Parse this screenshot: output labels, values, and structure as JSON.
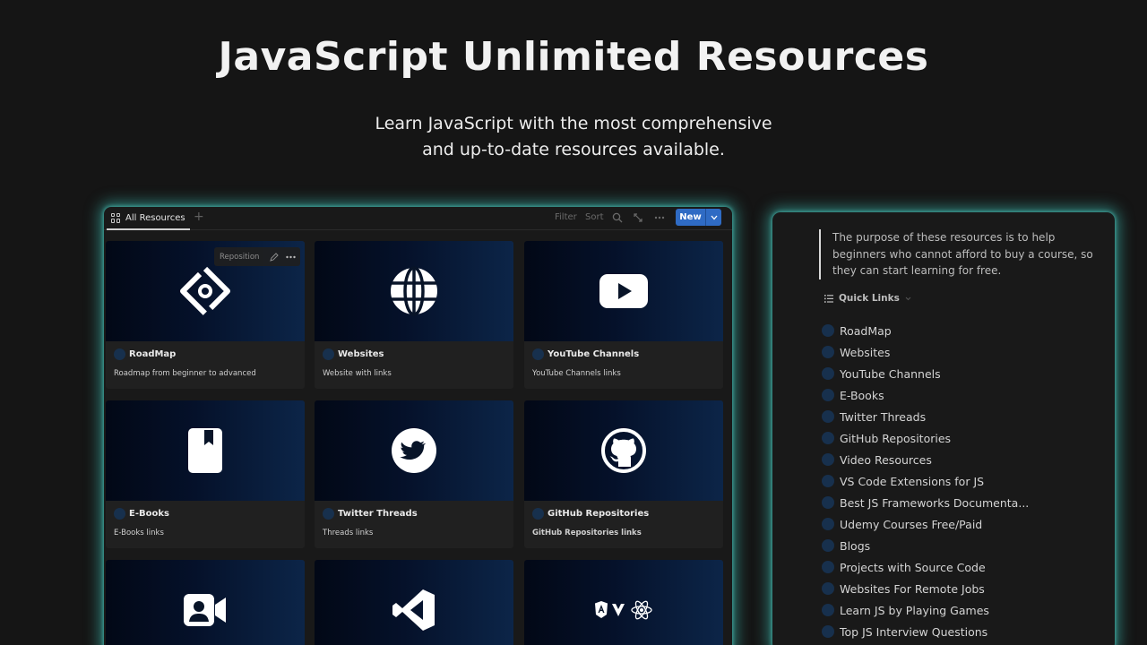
{
  "hero": {
    "title": "JavaScript Unlimited Resources",
    "subtitle_line1": "Learn JavaScript with the most comprehensive",
    "subtitle_line2": "and up-to-date resources available."
  },
  "database": {
    "tab_label": "All Resources",
    "add_symbol": "+",
    "filter_label": "Filter",
    "sort_label": "Sort",
    "new_label": "New",
    "hover_reposition": "Reposition",
    "cards": [
      {
        "title": "RoadMap",
        "desc": "Roadmap from beginner to advanced",
        "icon": "roadmap-icon"
      },
      {
        "title": "Websites",
        "desc": "Website with links",
        "icon": "globe-icon"
      },
      {
        "title": "YouTube Channels",
        "desc": "YouTube Channels links",
        "icon": "youtube-icon"
      },
      {
        "title": "E-Books",
        "desc": "E-Books links",
        "icon": "book-icon"
      },
      {
        "title": "Twitter Threads",
        "desc": "Threads links",
        "icon": "twitter-icon"
      },
      {
        "title": "GitHub Repositories",
        "desc": "GitHub Repositories links",
        "icon": "github-icon"
      },
      {
        "title": "",
        "desc": "",
        "icon": "video-call-icon"
      },
      {
        "title": "",
        "desc": "",
        "icon": "vscode-icon"
      },
      {
        "title": "",
        "desc": "",
        "icon": "frameworks-icon"
      }
    ]
  },
  "side": {
    "quote": "The purpose of these resources is to help beginners who cannot afford to buy a course, so they can start learning for free.",
    "quick_links_label": "Quick Links",
    "links": [
      "RoadMap",
      "Websites",
      "YouTube Channels",
      "E-Books",
      "Twitter Threads",
      "GitHub Repositories",
      "Video Resources",
      "VS Code Extensions for JS",
      "Best JS Frameworks Documenta...",
      "Udemy Courses Free/Paid",
      "Blogs",
      "Projects with Source Code",
      "Websites For Remote Jobs",
      "Learn JS by Playing Games",
      "Top JS Interview Questions"
    ]
  },
  "colors": {
    "background": "#151515",
    "panel_glow": "#40c8be",
    "new_button": "#2f6bc4",
    "page_icon_dot": "#17304d"
  }
}
